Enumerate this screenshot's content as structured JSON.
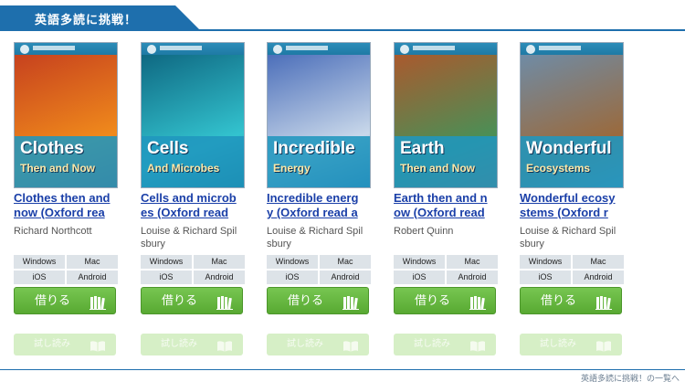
{
  "banner": {
    "title": "英語多読に挑戦！"
  },
  "books": [
    {
      "cover_title": "Clothes",
      "cover_subtitle": "Then and Now",
      "cover_colors": [
        "#c23a1e",
        "#f08a1c"
      ],
      "title": "Clothes then and\nnow (Oxford rea",
      "author": "Richard Northcott",
      "os": [
        "Windows",
        "Mac",
        "iOS",
        "Android"
      ],
      "borrow_label": "借りる",
      "read_label": "試し読み"
    },
    {
      "cover_title": "Cells",
      "cover_subtitle": "And Microbes",
      "cover_colors": [
        "#0b5f7a",
        "#33c3cf"
      ],
      "title": "Cells and microb\nes (Oxford read",
      "author": "Louise & Richard Spil\nsbury",
      "os": [
        "Windows",
        "Mac",
        "iOS",
        "Android"
      ],
      "borrow_label": "借りる",
      "read_label": "試し読み"
    },
    {
      "cover_title": "Incredible",
      "cover_subtitle": "Energy",
      "cover_colors": [
        "#3f64b5",
        "#c9d8ea"
      ],
      "title": "Incredible energ\ny (Oxford read a",
      "author": "Louise & Richard Spil\nsbury",
      "os": [
        "Windows",
        "Mac",
        "iOS",
        "Android"
      ],
      "borrow_label": "借りる",
      "read_label": "試し読み"
    },
    {
      "cover_title": "Earth",
      "cover_subtitle": "Then and Now",
      "cover_colors": [
        "#b3542a",
        "#4b8f56"
      ],
      "title": "Earth then and n\now (Oxford read",
      "author": "Robert Quinn",
      "os": [
        "Windows",
        "Mac",
        "iOS",
        "Android"
      ],
      "borrow_label": "借りる",
      "read_label": "試し読み"
    },
    {
      "cover_title": "Wonderful",
      "cover_subtitle": "Ecosystems",
      "cover_colors": [
        "#6b8fb0",
        "#9a6a3d"
      ],
      "title": "Wonderful ecosy\nstems (Oxford r",
      "author": "Louise & Richard Spil\nsbury",
      "os": [
        "Windows",
        "Mac",
        "iOS",
        "Android"
      ],
      "borrow_label": "借りる",
      "read_label": "試し読み"
    }
  ],
  "footer": {
    "note": "英語多読に挑戦！の一覧へ"
  },
  "colors": {
    "brand": "#1e6fad",
    "link": "#1a3fa8",
    "borrow_button": "#64b83d",
    "read_button_disabled": "#d6efc6"
  }
}
